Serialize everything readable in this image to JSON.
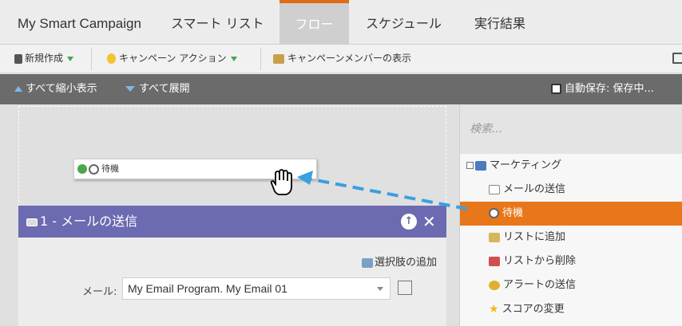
{
  "tabs": [
    {
      "label": "My Smart Campaign"
    },
    {
      "label": "スマート リスト"
    },
    {
      "label": "フロー"
    },
    {
      "label": "スケジュール"
    },
    {
      "label": "実行結果"
    }
  ],
  "toolbar": {
    "new": "新規作成",
    "actions": "キャンペーン アクション",
    "members": "キャンペーンメンバーの表示"
  },
  "subbar": {
    "collapse": "すべて縮小表示",
    "expand": "すべて展開",
    "autosave": "自動保存: 保存中..."
  },
  "drag_card": {
    "label": "待機"
  },
  "step": {
    "title": "1 - メールの送信",
    "add_choice": "選択肢の追加",
    "email_label": "メール:",
    "email_value": "My Email Program. My Email 01"
  },
  "panel": {
    "search_placeholder": "検索...",
    "group": "マーケティング",
    "items": [
      {
        "label": "メールの送信",
        "icon": "email-icon"
      },
      {
        "label": "待機",
        "icon": "clock-icon"
      },
      {
        "label": "リストに追加",
        "icon": "list-add-icon"
      },
      {
        "label": "リストから削除",
        "icon": "list-remove-icon"
      },
      {
        "label": "アラートの送信",
        "icon": "alert-icon"
      },
      {
        "label": "スコアの変更",
        "icon": "star-icon"
      }
    ]
  },
  "colors": {
    "accent": "#e8761a",
    "step_header": "#6c6ab0",
    "arrow": "#3aa0e0"
  }
}
